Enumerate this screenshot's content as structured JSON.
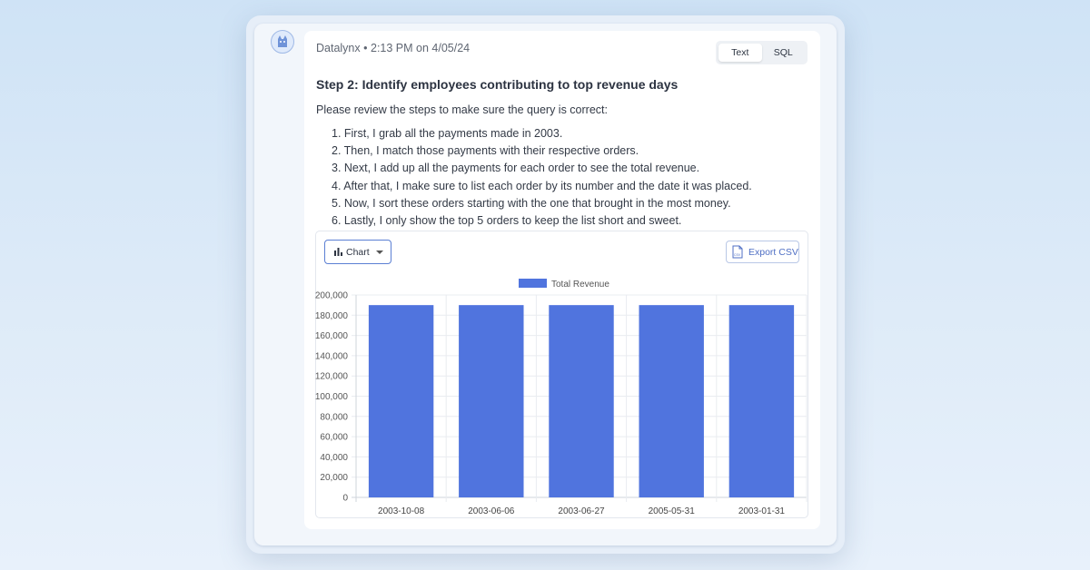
{
  "message": {
    "author": "Datalynx",
    "separator": "•",
    "time": "2:13 PM on 4/05/24",
    "title": "Step 2: Identify employees contributing to top revenue days",
    "intro": "Please review the steps to make sure the query is correct:",
    "steps": [
      "1. First, I grab all the payments made in 2003.",
      "2. Then, I match those payments with their respective orders.",
      "3. Next, I add up all the payments for each order to see the total revenue.",
      "4. After that, I make sure to list each order by its number and the date it was placed.",
      "5. Now, I sort these orders starting with the one that brought in the most money.",
      "6. Lastly, I only show the top 5 orders to keep the list short and sweet."
    ]
  },
  "toggle": {
    "text_label": "Text",
    "sql_label": "SQL",
    "active": "Text"
  },
  "chart_controls": {
    "view_label": "Chart",
    "export_label": "Export CSV",
    "csv_icon_text": "CSV"
  },
  "colors": {
    "bar": "#5074de",
    "accent": "#5b7fd3"
  },
  "icons": {
    "avatar": "cat-avatar-icon",
    "view": "bar-chart-icon",
    "export": "csv-file-icon",
    "dropdown": "caret-down-icon"
  },
  "chart_data": {
    "type": "bar",
    "categories": [
      "2003-10-08",
      "2003-06-06",
      "2003-06-27",
      "2005-05-31",
      "2003-01-31"
    ],
    "series": [
      {
        "name": "Total Revenue",
        "values": [
          190000,
          190000,
          190000,
          190000,
          190000
        ]
      }
    ],
    "yticks": [
      "0",
      "20,000",
      "40,000",
      "60,000",
      "80,000",
      "100,000",
      "120,000",
      "140,000",
      "160,000",
      "180,000",
      "200,000"
    ],
    "ylim": [
      0,
      200000
    ],
    "grid": true,
    "legend": "top-center"
  }
}
